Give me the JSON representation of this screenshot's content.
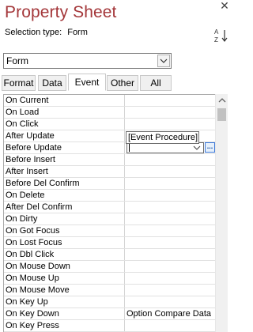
{
  "window": {
    "title": "Property Sheet",
    "close_glyph": "✕"
  },
  "selection": {
    "label": "Selection type:",
    "value": "Form"
  },
  "object_combo": {
    "value": "Form"
  },
  "tabs": [
    {
      "label": "Format",
      "active": false
    },
    {
      "label": "Data",
      "active": false
    },
    {
      "label": "Event",
      "active": true
    },
    {
      "label": "Other",
      "active": false
    },
    {
      "label": "All",
      "active": false
    }
  ],
  "properties": [
    {
      "name": "On Current",
      "value": ""
    },
    {
      "name": "On Load",
      "value": ""
    },
    {
      "name": "On Click",
      "value": ""
    },
    {
      "name": "After Update",
      "value": ""
    },
    {
      "name": "Before Update",
      "value": ""
    },
    {
      "name": "Before Insert",
      "value": ""
    },
    {
      "name": "After Insert",
      "value": ""
    },
    {
      "name": "Before Del Confirm",
      "value": ""
    },
    {
      "name": "On Delete",
      "value": ""
    },
    {
      "name": "After Del Confirm",
      "value": ""
    },
    {
      "name": "On Dirty",
      "value": ""
    },
    {
      "name": "On Got Focus",
      "value": ""
    },
    {
      "name": "On Lost Focus",
      "value": ""
    },
    {
      "name": "On Dbl Click",
      "value": ""
    },
    {
      "name": "On Mouse Down",
      "value": ""
    },
    {
      "name": "On Mouse Up",
      "value": ""
    },
    {
      "name": "On Mouse Move",
      "value": ""
    },
    {
      "name": "On Key Up",
      "value": ""
    },
    {
      "name": "On Key Down",
      "value": "Option Compare Data"
    },
    {
      "name": "On Key Press",
      "value": ""
    }
  ],
  "active_editor": {
    "row_label": "Before Update",
    "value": "",
    "builder_label": "..."
  },
  "dropdown_options": [
    "[Event Procedure]"
  ],
  "icons": {
    "sort": "sort-az-icon",
    "close": "close-icon",
    "dropdown": "chevron-down-icon",
    "builder": "builder-ellipsis-icon"
  },
  "colors": {
    "title": "#a4373a",
    "builder_border": "#3c78d8"
  }
}
